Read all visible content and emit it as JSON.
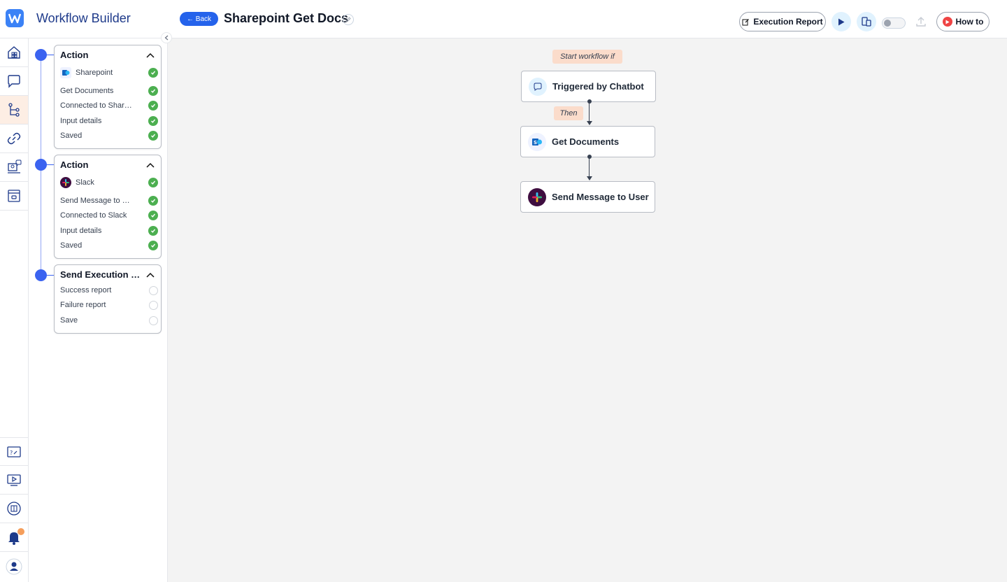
{
  "header": {
    "app_title": "Workflow Builder",
    "back_label": "← Back",
    "workflow_title": "Sharepoint Get Docs",
    "execution_report_label": "Execution Report",
    "how_to_label": "How to"
  },
  "rail": {
    "items": [
      "home-icon",
      "chat-icon",
      "workflow-icon",
      "link-icon",
      "agent-icon",
      "inbox-icon"
    ],
    "bottom_items": [
      "help-icon",
      "video-icon",
      "book-icon",
      "bell-icon",
      "user-icon"
    ]
  },
  "steps": [
    {
      "title": "Action",
      "app": "Sharepoint",
      "rows": [
        "Get Documents",
        "Connected to Sharepoint",
        "Input details",
        "Saved"
      ],
      "status": "complete"
    },
    {
      "title": "Action",
      "app": "Slack",
      "rows": [
        "Send Message to User",
        "Connected to Slack",
        "Input details",
        "Saved"
      ],
      "status": "complete"
    },
    {
      "title": "Send Execution Report",
      "rows": [
        "Success report",
        "Failure report",
        "Save"
      ],
      "status": "pending"
    }
  ],
  "canvas": {
    "start_label": "Start workflow if",
    "then_label": "Then",
    "trigger": "Triggered by Chatbot",
    "action1": "Get Documents",
    "action2": "Send Message to User"
  },
  "colors": {
    "primary": "#2563eb",
    "timeline": "#3b63f0",
    "check": "#4caf50",
    "pill": "#fbdccb",
    "active_rail": "#fdeee4"
  }
}
